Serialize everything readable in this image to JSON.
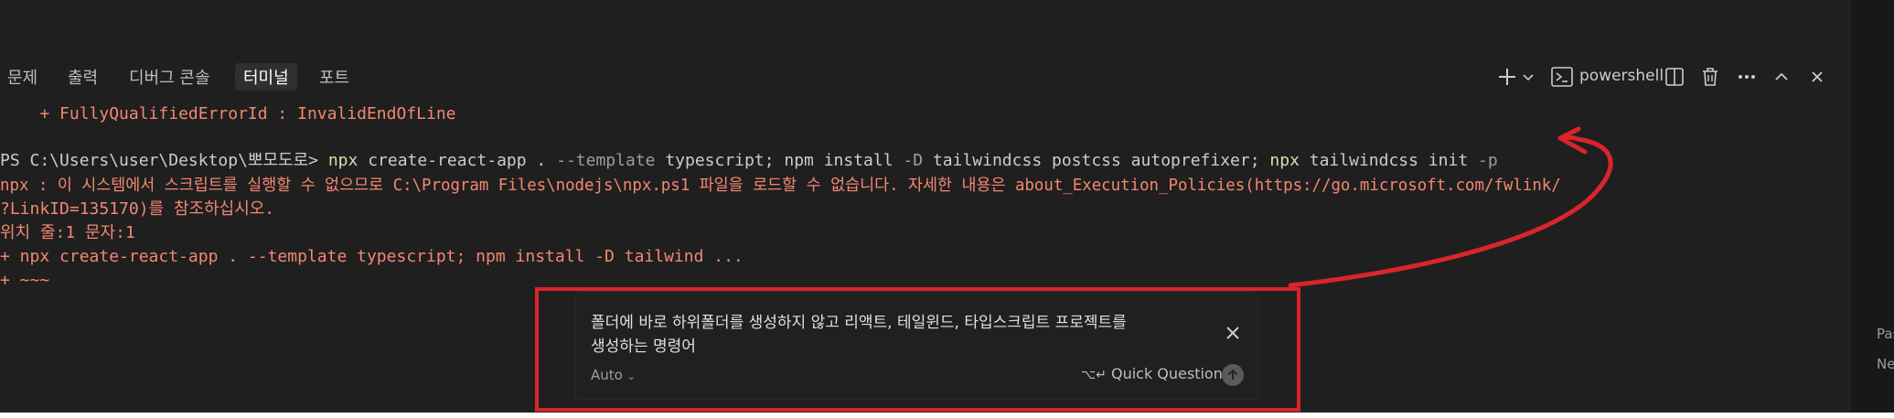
{
  "panel_tabs": [
    {
      "label": "문제"
    },
    {
      "label": "출력"
    },
    {
      "label": "디버그 콘솔"
    },
    {
      "label": "터미널",
      "active": true
    },
    {
      "label": "포트"
    }
  ],
  "toolbar": {
    "shell_name": "powershell",
    "icons": [
      "plus-icon",
      "chevron-down-icon",
      "terminal-icon",
      "split-icon",
      "trash-icon",
      "more-icon",
      "chevron-up-icon",
      "close-icon"
    ]
  },
  "terminal": {
    "line_prev_error": "    + FullyQualifiedErrorId : InvalidEndOfLine",
    "prompt": "PS C:\\Users\\user\\Desktop\\뽀모도로> ",
    "command": {
      "npx1": "npx",
      "part1": " create-react-app . ",
      "flag_template": "--template",
      "part2": " typescript; npm install ",
      "flag_d": "-D",
      "part3": " tailwindcss postcss autoprefixer; ",
      "npx2": "npx",
      "part4": " tailwindcss init ",
      "flag_p": "-p"
    },
    "error_line1": "npx : 이 시스템에서 스크립트를 실행할 수 없으므로 C:\\Program Files\\nodejs\\npx.ps1 파일을 로드할 수 없습니다. 자세한 내용은 about_Execution_Policies(https://go.microsoft.com/fwlink/",
    "error_line2": "?LinkID=135170)를 참조하십시오.",
    "error_line3": "위치 줄:1 문자:1",
    "error_line4": "+ npx create-react-app . --template typescript; npm install -D tailwind ...",
    "error_line5": "+ ~~~"
  },
  "chat": {
    "prompt_line1": "폴더에 바로 하위폴더를 생성하지 않고 리액트, 테일윈드, 타입스크립트 프로젝트를",
    "prompt_line2": "생성하는 명령어",
    "mode": "Auto",
    "shortcut_label": "Quick Question"
  },
  "sidebar": {
    "text1": "Pas",
    "text2": "Ne"
  },
  "colors": {
    "panel_bg": "#1f1f1f",
    "error_red": "#f48771",
    "command_yellow": "#dcdcaa",
    "annotation_red": "#d9252b"
  }
}
